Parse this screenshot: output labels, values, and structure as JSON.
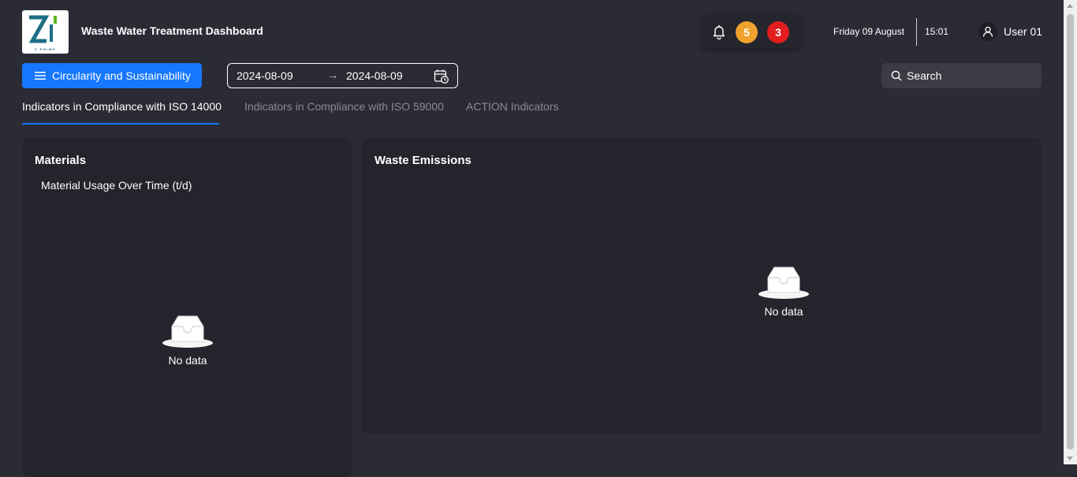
{
  "header": {
    "logo_text": "Z PRIME",
    "title": "Waste Water Treatment Dashboard",
    "notifications": {
      "warning_count": "5",
      "alert_count": "3"
    },
    "date": "Friday 09 August",
    "time": "15:01",
    "user": "User 01"
  },
  "toolbar": {
    "menu_label": "Circularity and Sustainability",
    "date_start": "2024-08-09",
    "date_arrow": "→",
    "date_end": "2024-08-09",
    "search_placeholder": "Search"
  },
  "tabs": [
    {
      "label": "Indicators in Compliance with ISO 14000",
      "active": true
    },
    {
      "label": "Indicators in Compliance with ISO 59000",
      "active": false
    },
    {
      "label": "ACTION Indicators",
      "active": false
    }
  ],
  "cards": {
    "materials": {
      "title": "Materials",
      "subtitle": "Material Usage Over Time (t/d)",
      "empty": "No data"
    },
    "waste": {
      "title": "Waste Emissions",
      "empty": "No data"
    }
  },
  "colors": {
    "accent": "#1677ff",
    "background": "#2a2b34",
    "card": "#23242c",
    "badge_warning": "#f0a22e",
    "badge_alert": "#e31d1d"
  }
}
